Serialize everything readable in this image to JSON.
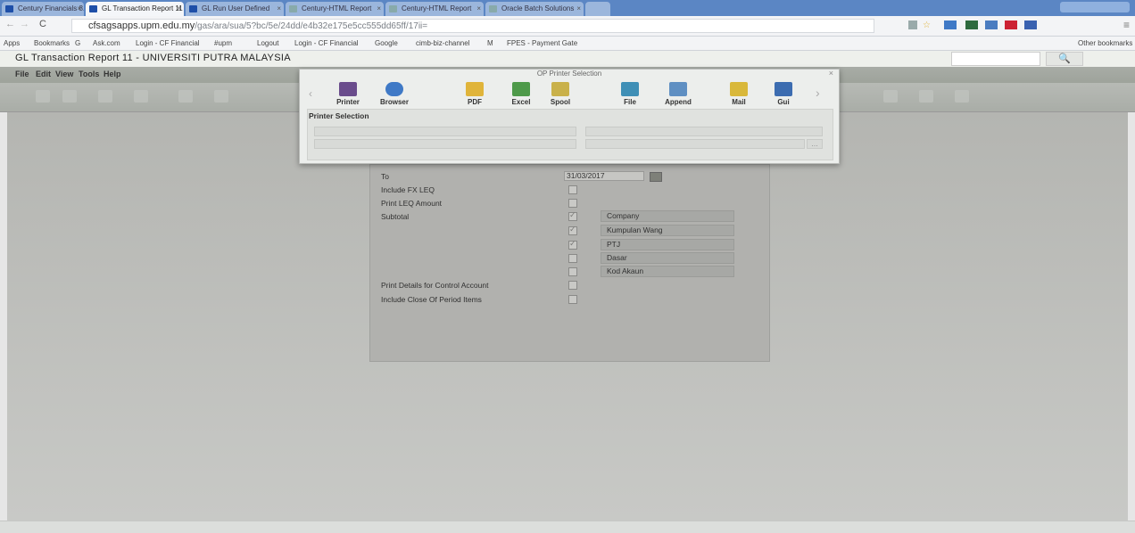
{
  "browser": {
    "tabs": [
      {
        "label": "Century Financials 8.x"
      },
      {
        "label": "GL Transaction Report 11"
      },
      {
        "label": "GL Run User Defined"
      },
      {
        "label": "Century-HTML Report"
      },
      {
        "label": "Century-HTML Report"
      },
      {
        "label": "Oracle Batch Solutions"
      }
    ],
    "url_domain": "cfsagsapps.upm.edu.my",
    "url_path": "/gas/ara/sua/5?bc/5e/24dd/e4b32e175e5cc555dd65ff/17ii=",
    "bookmarks": [
      "Apps",
      "Bookmarks",
      "G",
      "Ask.com",
      "Login - CF Financial",
      "#upm",
      "Logout",
      "Login - CF Financial",
      "Google",
      "cimb-biz-channel",
      "M",
      "FPES - Payment Gate"
    ],
    "other_bookmarks": "Other bookmarks"
  },
  "app": {
    "title": "GL Transaction Report 11 - UNIVERSITI PUTRA MALAYSIA",
    "menu": [
      "File",
      "Edit",
      "View",
      "Tools",
      "Help"
    ]
  },
  "dialog": {
    "title": "OP Printer Selection",
    "buttons": [
      {
        "label": "Printer",
        "icon": "printer-icon",
        "color": "#6a4c8c"
      },
      {
        "label": "Browser",
        "icon": "globe-icon",
        "color": "#3f79c6"
      },
      {
        "label": "PDF",
        "icon": "folder-icon",
        "color": "#e0b43a"
      },
      {
        "label": "Excel",
        "icon": "excel-icon",
        "color": "#4e9a4a"
      },
      {
        "label": "Spool",
        "icon": "spool-icon",
        "color": "#c9b14a"
      },
      {
        "label": "File",
        "icon": "file-icon",
        "color": "#3f8fb6"
      },
      {
        "label": "Append",
        "icon": "append-icon",
        "color": "#5f8fc2"
      },
      {
        "label": "Mail",
        "icon": "mail-icon",
        "color": "#d9b83a"
      },
      {
        "label": "Gui",
        "icon": "gui-icon",
        "color": "#3c6cb0"
      },
      {
        "label": "",
        "icon": "more-icon",
        "color": "#9aa0a8"
      }
    ],
    "section_title": "Printer Selection"
  },
  "form": {
    "to_label": "To",
    "to_value": "31/03/2017",
    "include_fx_leq": "Include FX LEQ",
    "print_leq_amount": "Print LEQ Amount",
    "subtotal": "Subtotal",
    "subtotal_items": [
      "Company",
      "Kumpulan Wang",
      "PTJ",
      "Dasar",
      "Kod Akaun"
    ],
    "print_details_control": "Print Details for Control Account",
    "include_close_period": "Include Close Of Period Items"
  },
  "colors": {
    "tabbar": "#5b86c4",
    "workspace": "#b4b5b1",
    "dialog_bg": "#eceeec"
  }
}
